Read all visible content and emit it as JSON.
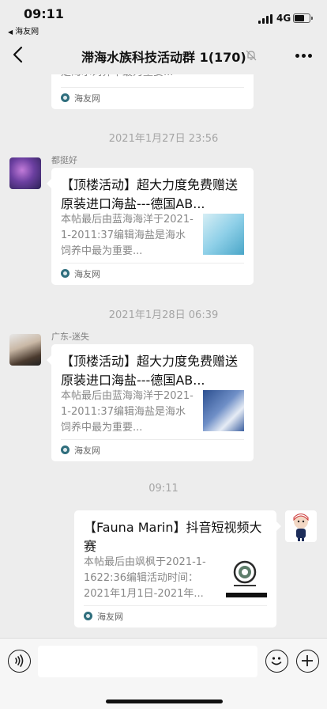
{
  "status": {
    "time": "09:11",
    "back_app": "海友网",
    "network": "4G"
  },
  "header": {
    "title": "滞海水族科技活动群 1(170)"
  },
  "messages": [
    {
      "desc_tail": "是海水饲养中最为重要...",
      "source": "海友网"
    },
    {
      "timestamp": "2021年1月27日 23:56",
      "sender": "都挺好",
      "title": "【顶楼活动】超大力度免费赠送原装进口海盐---德国AB...",
      "desc": "本帖最后由蓝海海洋于2021-1-2011:37编辑海盐是海水饲养中最为重要...",
      "source": "海友网"
    },
    {
      "timestamp": "2021年1月28日 06:39",
      "sender": "广东-迷失",
      "title": "【顶楼活动】超大力度免费赠送原装进口海盐---德国AB...",
      "desc": "本帖最后由蓝海海洋于2021-1-2011:37编辑海盐是海水饲养中最为重要...",
      "source": "海友网"
    },
    {
      "timestamp": "09:11",
      "title": "【Fauna Marin】抖音短视频大赛",
      "desc": "本帖最后由飒枫于2021-1-1622:36编辑活动时间：2021年1月1日-2021年...",
      "source": "海友网"
    }
  ],
  "input": {
    "placeholder": ""
  }
}
